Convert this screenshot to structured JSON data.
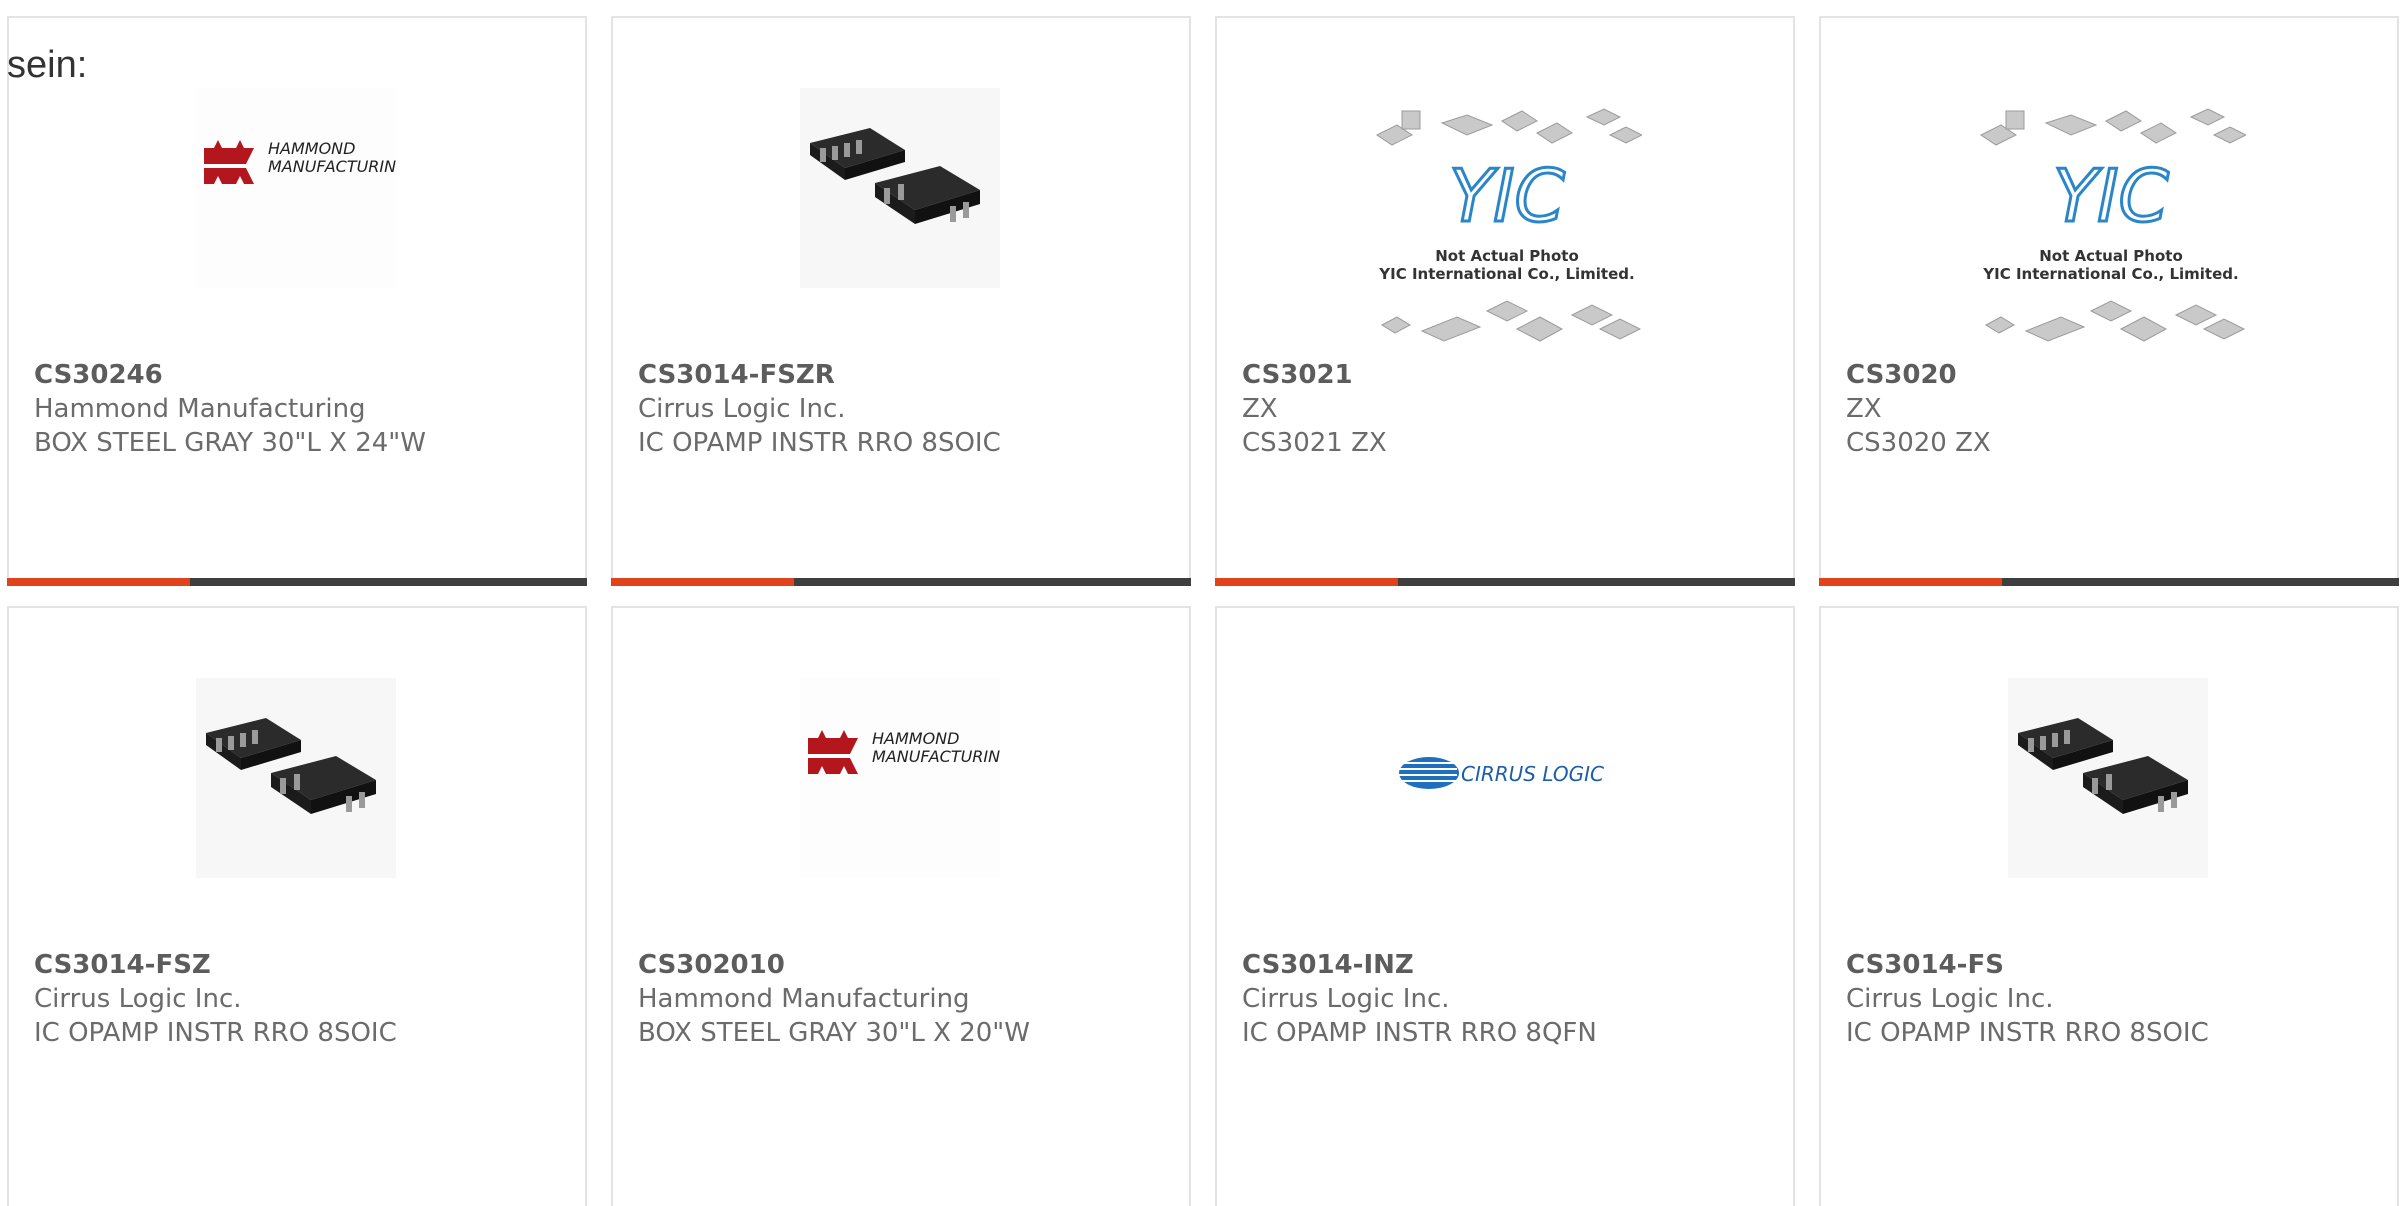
{
  "lead_text": "sein:",
  "colors": {
    "accent": "#e0421b",
    "bar": "#3e3e3e",
    "border": "#e3e3e3",
    "text": "#6b6b6b"
  },
  "products": [
    {
      "part": "CS30246",
      "manufacturer": "Hammond Manufacturing",
      "description": "BOX STEEL GRAY 30\"L X 24\"W",
      "image": "hammond-logo"
    },
    {
      "part": "CS3014-FSZR",
      "manufacturer": "Cirrus Logic Inc.",
      "description": "IC OPAMP INSTR RRO 8SOIC",
      "image": "soic-chip"
    },
    {
      "part": "CS3021",
      "manufacturer": "ZX",
      "description": "CS3021 ZX",
      "image": "yic-placeholder"
    },
    {
      "part": "CS3020",
      "manufacturer": "ZX",
      "description": "CS3020 ZX",
      "image": "yic-placeholder"
    },
    {
      "part": "CS3014-FSZ",
      "manufacturer": "Cirrus Logic Inc.",
      "description": "IC OPAMP INSTR RRO 8SOIC",
      "image": "soic-chip"
    },
    {
      "part": "CS302010",
      "manufacturer": "Hammond Manufacturing",
      "description": "BOX STEEL GRAY 30\"L X 20\"W",
      "image": "hammond-logo"
    },
    {
      "part": "CS3014-INZ",
      "manufacturer": "Cirrus Logic Inc.",
      "description": "IC OPAMP INSTR RRO 8QFN",
      "image": "cirrus-logic-logo"
    },
    {
      "part": "CS3014-FS",
      "manufacturer": "Cirrus Logic Inc.",
      "description": "IC OPAMP INSTR RRO 8SOIC",
      "image": "soic-chip"
    }
  ],
  "logos": {
    "hammond_line1": "HAMMOND",
    "hammond_line2": "MANUFACTURING.",
    "yic_brand": "YIC",
    "yic_note1": "Not Actual Photo",
    "yic_note2": "YIC International Co., Limited.",
    "cirrus": "CIRRUS LOGIC"
  }
}
